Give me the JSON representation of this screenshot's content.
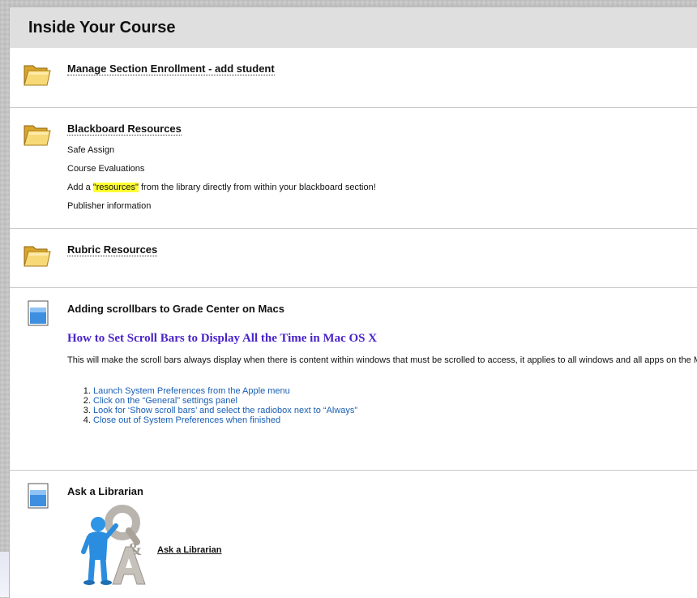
{
  "page": {
    "title": "Inside Your Course"
  },
  "items": [
    {
      "title": "Manage Section Enrollment - add student",
      "icon": "folder-icon"
    },
    {
      "title": "Blackboard Resources",
      "icon": "folder-icon",
      "links": {
        "safe_assign": "Safe Assign",
        "course_evaluations": "Course Evaluations",
        "add_prefix": "Add a ",
        "resources_highlight": "\"resources\"",
        "add_suffix": " from the library directly from within your blackboard section!",
        "publisher": "Publisher information"
      }
    },
    {
      "title": "Rubric Resources",
      "icon": "folder-icon"
    },
    {
      "title": "Adding scrollbars to Grade Center on Macs",
      "icon": "document-icon",
      "heading": "How to Set Scroll Bars to Display All the Time in Mac OS X",
      "description": "This will make the scroll bars always display when there is content within windows that must be scrolled to access, it applies to all windows and all apps on the Mac:",
      "steps": [
        {
          "before": "Launch System Preferences from the ",
          "glyph": "",
          "after": " Apple menu"
        },
        "Click on the “General” settings panel",
        "Look for ‘Show scroll bars’ and select the radiobox next to “Always”",
        "Close out of System Preferences when finished"
      ]
    },
    {
      "title": "Ask a Librarian",
      "icon": "document-icon",
      "link": "Ask a Librarian",
      "image": "qa-person-icon"
    }
  ],
  "colors": {
    "header_bg": "#dfdfdf",
    "link_blue": "#1a5fb4",
    "heading_purple": "#4a23c9",
    "highlight": "#ffff33"
  }
}
